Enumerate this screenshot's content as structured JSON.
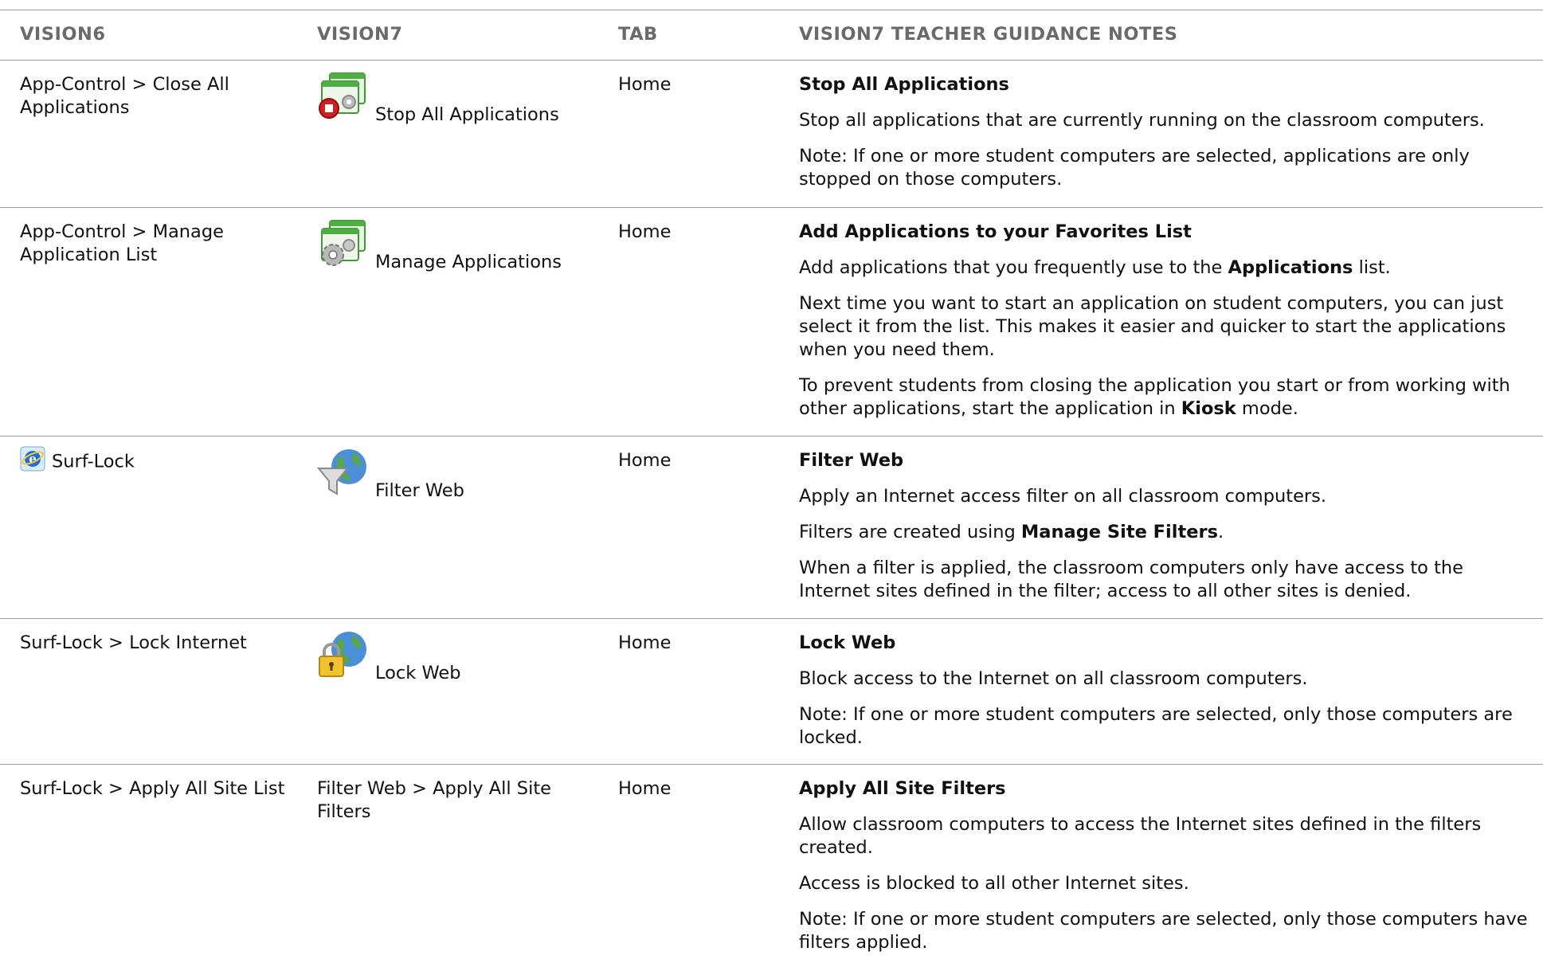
{
  "headers": {
    "col1": "VISION6",
    "col2": "VISION7",
    "col3": "TAB",
    "col4": "VISION7 TEACHER GUIDANCE NOTES"
  },
  "rows": [
    {
      "vision6": "App-Control > Close All Applications",
      "vision7_icon": "stop-applications-icon",
      "vision7_label": "Stop All Applications",
      "tab": "Home",
      "notes_title": "Stop All Applications",
      "notes": [
        "Stop all applications that are currently running on the classroom computers.",
        "Note:  If one or more student computers are selected, applications are only stopped on those computers."
      ]
    },
    {
      "vision6": "App-Control > Manage Application List",
      "vision7_icon": "manage-applications-icon",
      "vision7_label": "Manage Applications",
      "tab": "Home",
      "notes_title": "Add Applications to your Favorites List",
      "notes": [
        {
          "pre": "Add applications that you frequently use to the ",
          "bold": "Applications",
          "post": " list."
        },
        "Next time you want to start an application on student computers, you can just select it from the list. This makes it easier and quicker to start the applications when you need them.",
        {
          "pre": "To prevent students from closing the application you start or from working with other applications, start the application in ",
          "bold": "Kiosk",
          "post": " mode."
        }
      ]
    },
    {
      "vision6": "Surf-Lock",
      "vision6_icon": "internet-explorer-icon",
      "vision7_icon": "filter-web-icon",
      "vision7_label": "Filter Web",
      "tab": "Home",
      "notes_title": "Filter Web",
      "notes": [
        "Apply an Internet access filter on all classroom computers.",
        {
          "pre": "Filters are created using ",
          "bold": "Manage Site Filters",
          "post": "."
        },
        "When a filter is applied, the classroom computers only have access to the Internet sites defined in the filter; access to all other sites is denied."
      ]
    },
    {
      "vision6": "Surf-Lock > Lock Internet",
      "vision7_icon": "lock-web-icon",
      "vision7_label": "Lock Web",
      "tab": "Home",
      "notes_title": "Lock Web",
      "notes": [
        "Block access to the Internet on all classroom computers.",
        "Note: If one or more student computers are selected, only those computers are locked."
      ]
    },
    {
      "vision6": "Surf-Lock > Apply All Site List",
      "vision7_text": "Filter Web > Apply All Site Filters",
      "tab": "Home",
      "notes_title": "Apply All Site Filters",
      "notes": [
        "Allow classroom computers to access the Internet sites defined in the filters created.",
        "Access is blocked to all other Internet sites.",
        "Note: If one or more student computers are selected, only those computers have filters applied."
      ]
    }
  ]
}
